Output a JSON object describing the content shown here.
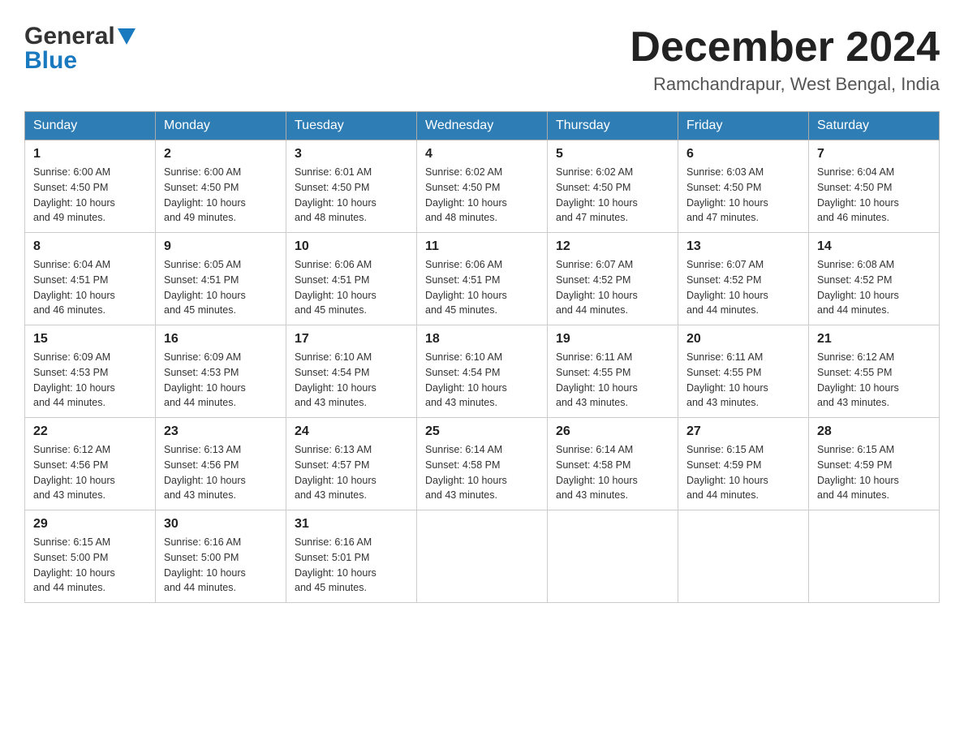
{
  "header": {
    "logo_text_general": "General",
    "logo_text_blue": "Blue",
    "month_title": "December 2024",
    "location": "Ramchandrapur, West Bengal, India"
  },
  "weekdays": [
    "Sunday",
    "Monday",
    "Tuesday",
    "Wednesday",
    "Thursday",
    "Friday",
    "Saturday"
  ],
  "weeks": [
    [
      {
        "day": "1",
        "sunrise": "6:00 AM",
        "sunset": "4:50 PM",
        "daylight": "10 hours and 49 minutes."
      },
      {
        "day": "2",
        "sunrise": "6:00 AM",
        "sunset": "4:50 PM",
        "daylight": "10 hours and 49 minutes."
      },
      {
        "day": "3",
        "sunrise": "6:01 AM",
        "sunset": "4:50 PM",
        "daylight": "10 hours and 48 minutes."
      },
      {
        "day": "4",
        "sunrise": "6:02 AM",
        "sunset": "4:50 PM",
        "daylight": "10 hours and 48 minutes."
      },
      {
        "day": "5",
        "sunrise": "6:02 AM",
        "sunset": "4:50 PM",
        "daylight": "10 hours and 47 minutes."
      },
      {
        "day": "6",
        "sunrise": "6:03 AM",
        "sunset": "4:50 PM",
        "daylight": "10 hours and 47 minutes."
      },
      {
        "day": "7",
        "sunrise": "6:04 AM",
        "sunset": "4:50 PM",
        "daylight": "10 hours and 46 minutes."
      }
    ],
    [
      {
        "day": "8",
        "sunrise": "6:04 AM",
        "sunset": "4:51 PM",
        "daylight": "10 hours and 46 minutes."
      },
      {
        "day": "9",
        "sunrise": "6:05 AM",
        "sunset": "4:51 PM",
        "daylight": "10 hours and 45 minutes."
      },
      {
        "day": "10",
        "sunrise": "6:06 AM",
        "sunset": "4:51 PM",
        "daylight": "10 hours and 45 minutes."
      },
      {
        "day": "11",
        "sunrise": "6:06 AM",
        "sunset": "4:51 PM",
        "daylight": "10 hours and 45 minutes."
      },
      {
        "day": "12",
        "sunrise": "6:07 AM",
        "sunset": "4:52 PM",
        "daylight": "10 hours and 44 minutes."
      },
      {
        "day": "13",
        "sunrise": "6:07 AM",
        "sunset": "4:52 PM",
        "daylight": "10 hours and 44 minutes."
      },
      {
        "day": "14",
        "sunrise": "6:08 AM",
        "sunset": "4:52 PM",
        "daylight": "10 hours and 44 minutes."
      }
    ],
    [
      {
        "day": "15",
        "sunrise": "6:09 AM",
        "sunset": "4:53 PM",
        "daylight": "10 hours and 44 minutes."
      },
      {
        "day": "16",
        "sunrise": "6:09 AM",
        "sunset": "4:53 PM",
        "daylight": "10 hours and 44 minutes."
      },
      {
        "day": "17",
        "sunrise": "6:10 AM",
        "sunset": "4:54 PM",
        "daylight": "10 hours and 43 minutes."
      },
      {
        "day": "18",
        "sunrise": "6:10 AM",
        "sunset": "4:54 PM",
        "daylight": "10 hours and 43 minutes."
      },
      {
        "day": "19",
        "sunrise": "6:11 AM",
        "sunset": "4:55 PM",
        "daylight": "10 hours and 43 minutes."
      },
      {
        "day": "20",
        "sunrise": "6:11 AM",
        "sunset": "4:55 PM",
        "daylight": "10 hours and 43 minutes."
      },
      {
        "day": "21",
        "sunrise": "6:12 AM",
        "sunset": "4:55 PM",
        "daylight": "10 hours and 43 minutes."
      }
    ],
    [
      {
        "day": "22",
        "sunrise": "6:12 AM",
        "sunset": "4:56 PM",
        "daylight": "10 hours and 43 minutes."
      },
      {
        "day": "23",
        "sunrise": "6:13 AM",
        "sunset": "4:56 PM",
        "daylight": "10 hours and 43 minutes."
      },
      {
        "day": "24",
        "sunrise": "6:13 AM",
        "sunset": "4:57 PM",
        "daylight": "10 hours and 43 minutes."
      },
      {
        "day": "25",
        "sunrise": "6:14 AM",
        "sunset": "4:58 PM",
        "daylight": "10 hours and 43 minutes."
      },
      {
        "day": "26",
        "sunrise": "6:14 AM",
        "sunset": "4:58 PM",
        "daylight": "10 hours and 43 minutes."
      },
      {
        "day": "27",
        "sunrise": "6:15 AM",
        "sunset": "4:59 PM",
        "daylight": "10 hours and 44 minutes."
      },
      {
        "day": "28",
        "sunrise": "6:15 AM",
        "sunset": "4:59 PM",
        "daylight": "10 hours and 44 minutes."
      }
    ],
    [
      {
        "day": "29",
        "sunrise": "6:15 AM",
        "sunset": "5:00 PM",
        "daylight": "10 hours and 44 minutes."
      },
      {
        "day": "30",
        "sunrise": "6:16 AM",
        "sunset": "5:00 PM",
        "daylight": "10 hours and 44 minutes."
      },
      {
        "day": "31",
        "sunrise": "6:16 AM",
        "sunset": "5:01 PM",
        "daylight": "10 hours and 45 minutes."
      },
      null,
      null,
      null,
      null
    ]
  ],
  "labels": {
    "sunrise": "Sunrise:",
    "sunset": "Sunset:",
    "daylight": "Daylight:"
  }
}
